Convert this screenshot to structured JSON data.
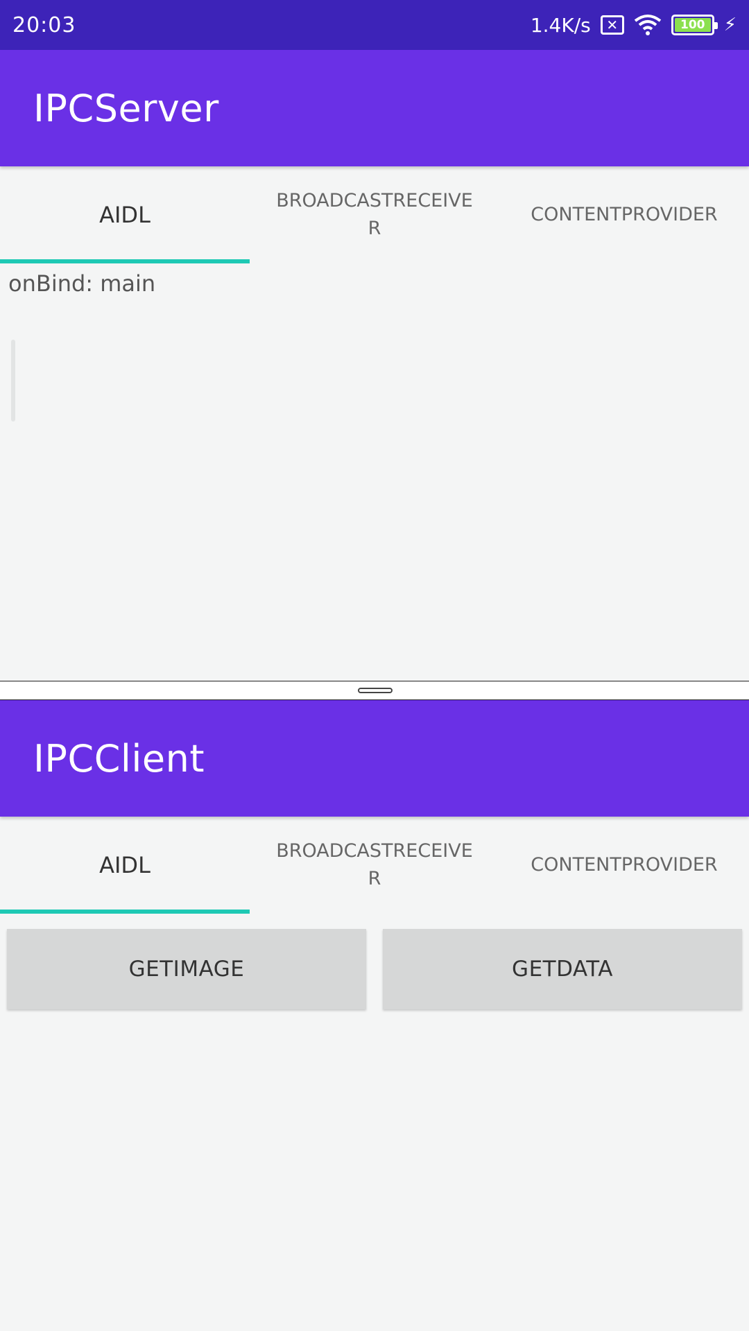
{
  "status_bar": {
    "time": "20:03",
    "net_speed": "1.4K/s",
    "sim_icon": "sim-no-service-icon",
    "wifi_icon": "wifi-icon",
    "battery_level": "100",
    "charging_icon": "bolt-icon"
  },
  "colors": {
    "status_bar": "#3d23b8",
    "app_bar": "#6a30e6",
    "tab_indicator": "#1ec9b4",
    "background": "#f4f5f5",
    "button": "#d6d7d7"
  },
  "server": {
    "title": "IPCServer",
    "tabs": [
      {
        "label": "AIDL",
        "selected": true
      },
      {
        "label": "BROADCASTRECEIVER",
        "selected": false
      },
      {
        "label": "CONTENTPROVIDER",
        "selected": false
      }
    ],
    "log_text": "onBind: main"
  },
  "client": {
    "title": "IPCClient",
    "tabs": [
      {
        "label": "AIDL",
        "selected": true
      },
      {
        "label": "BROADCASTRECEIVER",
        "selected": false
      },
      {
        "label": "CONTENTPROVIDER",
        "selected": false
      }
    ],
    "buttons": {
      "get_image": "GETIMAGE",
      "get_data": "GETDATA"
    }
  }
}
